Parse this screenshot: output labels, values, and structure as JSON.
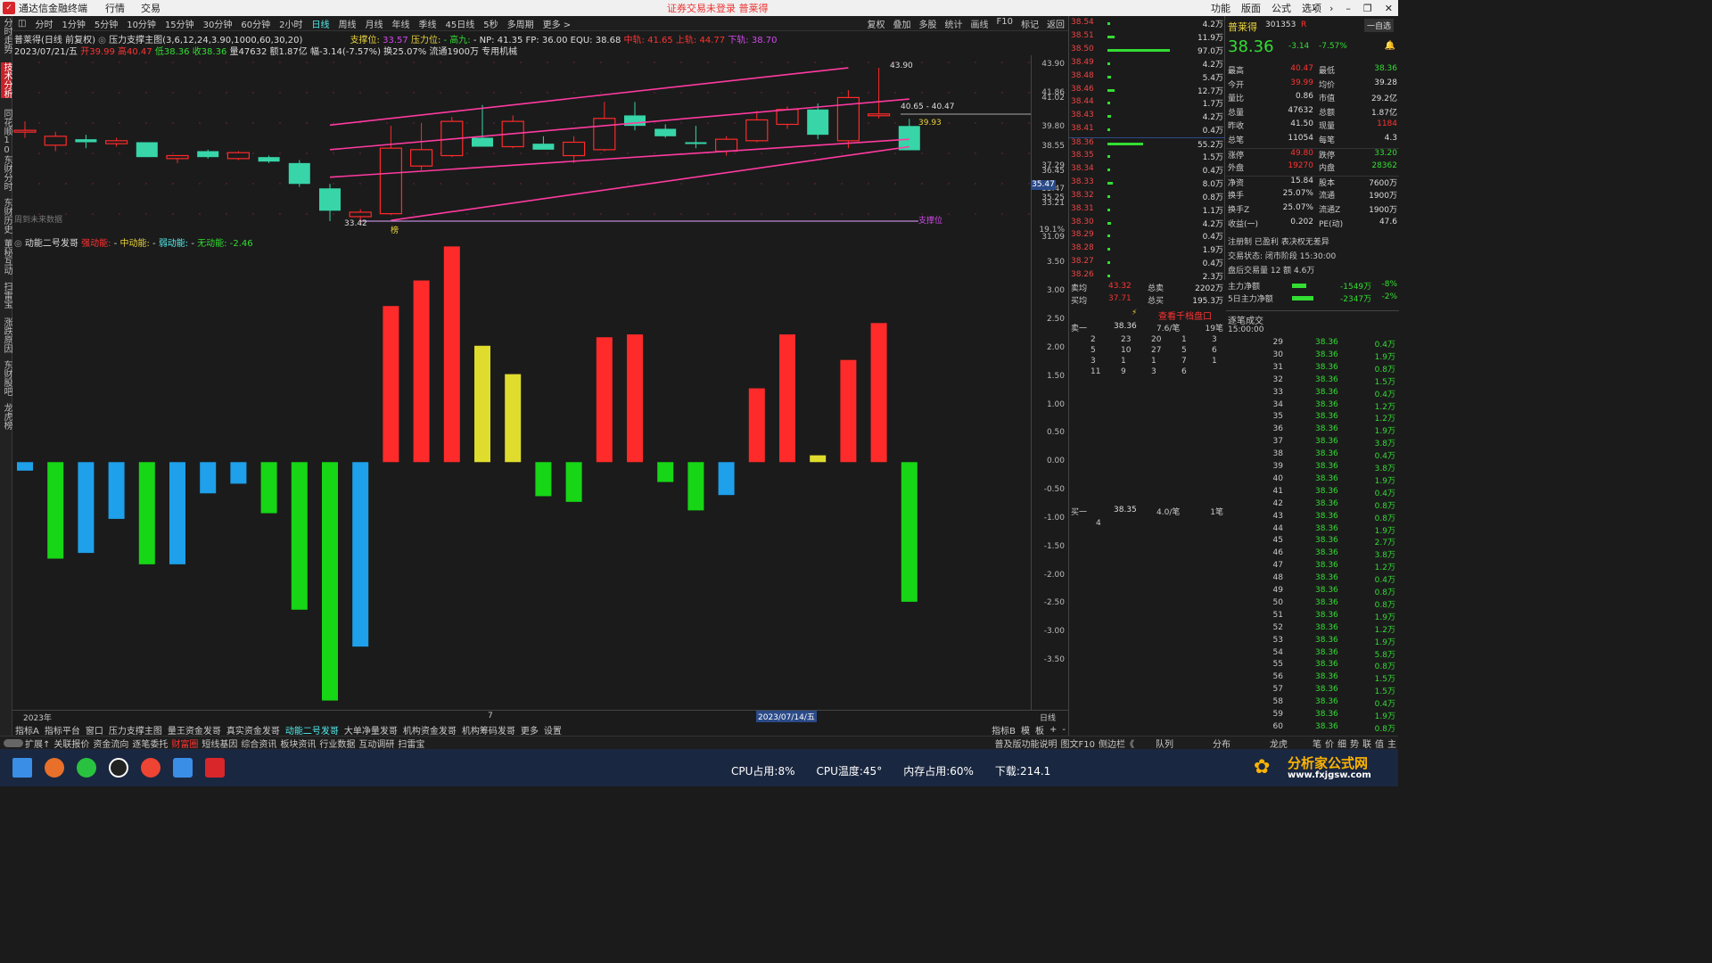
{
  "titlebar": {
    "app_name": "通达信金融终端",
    "menu": [
      "行情",
      "交易"
    ],
    "notice": "证券交易未登录  普莱得",
    "right_menu": [
      "功能",
      "版面",
      "公式",
      "选项"
    ]
  },
  "left_tabs": [
    "分时走势",
    "技术分析",
    "同花顺10",
    "东财分时",
    "东财历史",
    "董秘互动",
    "扫雷宝",
    "涨跌原因",
    "东财股吧",
    "龙虎榜"
  ],
  "periods": [
    "分时",
    "1分钟",
    "5分钟",
    "10分钟",
    "15分钟",
    "30分钟",
    "60分钟",
    "2小时",
    "日线",
    "周线",
    "月线",
    "年线",
    "季线",
    "45日线",
    "5秒",
    "多周期",
    "更多 >"
  ],
  "active_period": "日线",
  "period_right": [
    "复权",
    "叠加",
    "多股",
    "统计",
    "画线",
    "F10",
    "标记",
    "返回"
  ],
  "info_line1": {
    "stock": "普莱得(日线 前复权)",
    "indicator": "压力支撑主图(3,6,12,24,3.90,1000,60,30,20)",
    "support_label": "支撑位:",
    "support_val": "33.57",
    "pressure_label": "压力位:",
    "gaojiu": "- 高九:",
    "np": "- NP: 41.35 FP: 36.00 EQU: 38.68",
    "mid": "中轨: 41.65",
    "upper": "上轨: 44.77",
    "lower": "下轨: 38.70"
  },
  "info_line2": {
    "date": "2023/07/21/五",
    "open": "开39.99",
    "high": "高40.47",
    "low": "低38.36",
    "close": "收38.36",
    "rest": "量47632 额1.87亿 幅-3.14(-7.57%) 换25.07% 流通1900万 专用机械"
  },
  "main_axis_ticks": [
    "43.90",
    "41.86",
    "41.02",
    "39.80",
    "38.55",
    "37.29",
    "36.45",
    "35.47",
    "35.25",
    "33.21",
    "19.1%",
    "31.09"
  ],
  "main_annotations": {
    "high_mark": "43.90",
    "low_mark": "33.42",
    "range_label": "40.65 - 40.47",
    "last_mark": "39.93",
    "support_line": "支撑位",
    "no_data": "周到未来数据",
    "tag": "榜",
    "price_flag": "35.47"
  },
  "sub_header": {
    "title": "动能二号发哥",
    "strong": "强动能:",
    "mid": "中动能:",
    "weak": "弱动能:",
    "none": "无动能:",
    "none_val": "-2.46"
  },
  "sub_axis_ticks": [
    "3.50",
    "3.00",
    "2.50",
    "2.00",
    "1.50",
    "1.00",
    "0.50",
    "0.00",
    "-0.50",
    "-1.00",
    "-1.50",
    "-2.00",
    "-2.50",
    "-3.00",
    "-3.50"
  ],
  "date_bar": {
    "left": "2023年",
    "mid": "7",
    "sel": "2023/07/14/五",
    "right": "日线"
  },
  "tabbar1": [
    "指标A",
    "指标平台",
    "窗口",
    "压力支撑主图",
    "量王资金发哥",
    "真实资金发哥",
    "动能二号发哥",
    "大单净量发哥",
    "机构资金发哥",
    "机构筹码发哥",
    "更多",
    "设置"
  ],
  "tabbar1_active": "动能二号发哥",
  "tabbar1_right": [
    "指标B",
    "模",
    "板",
    "+",
    "-"
  ],
  "tabbar2": [
    "扩展↑",
    "关联报价",
    "资金流向",
    "逐笔委托",
    "财富圈",
    "短线基因",
    "综合资讯",
    "板块资讯",
    "行业数据",
    "互动调研",
    "扫雷宝"
  ],
  "tabbar2_active": "财富圈",
  "tabbar2_right": [
    "普及版功能说明",
    "图文F10",
    "侧边栏《",
    "队列",
    "分布",
    "龙虎",
    "笔",
    "价",
    "细",
    "势",
    "联",
    "值",
    "主"
  ],
  "chart_data": [
    {
      "type": "candlestick",
      "title": "普莱得(日线 前复权)",
      "ylim": [
        33.0,
        44.5
      ],
      "candles": [
        {
          "o": 39.7,
          "h": 40.3,
          "l": 39.2,
          "c": 39.7,
          "color": "red"
        },
        {
          "o": 38.7,
          "h": 39.6,
          "l": 38.3,
          "c": 39.3,
          "color": "red"
        },
        {
          "o": 39.1,
          "h": 39.4,
          "l": 38.5,
          "c": 38.9,
          "color": "cyan"
        },
        {
          "o": 38.8,
          "h": 39.2,
          "l": 38.6,
          "c": 39.0,
          "color": "red"
        },
        {
          "o": 38.9,
          "h": 38.9,
          "l": 37.9,
          "c": 37.9,
          "color": "cyan"
        },
        {
          "o": 37.8,
          "h": 38.0,
          "l": 37.5,
          "c": 38.0,
          "color": "red"
        },
        {
          "o": 38.3,
          "h": 38.4,
          "l": 37.8,
          "c": 37.9,
          "color": "cyan"
        },
        {
          "o": 37.8,
          "h": 38.3,
          "l": 37.7,
          "c": 38.2,
          "color": "red"
        },
        {
          "o": 37.9,
          "h": 38.0,
          "l": 37.5,
          "c": 37.6,
          "color": "cyan"
        },
        {
          "o": 37.5,
          "h": 37.7,
          "l": 35.9,
          "c": 36.1,
          "color": "cyan"
        },
        {
          "o": 35.8,
          "h": 36.1,
          "l": 33.6,
          "c": 34.3,
          "color": "cyan"
        },
        {
          "o": 33.9,
          "h": 34.4,
          "l": 33.4,
          "c": 34.2,
          "color": "red"
        },
        {
          "o": 34.1,
          "h": 40.0,
          "l": 34.0,
          "c": 38.5,
          "color": "red"
        },
        {
          "o": 37.3,
          "h": 40.2,
          "l": 37.0,
          "c": 38.4,
          "color": "red"
        },
        {
          "o": 38.0,
          "h": 40.6,
          "l": 37.9,
          "c": 40.3,
          "color": "red"
        },
        {
          "o": 39.2,
          "h": 41.4,
          "l": 38.6,
          "c": 38.6,
          "color": "cyan"
        },
        {
          "o": 38.6,
          "h": 40.7,
          "l": 38.5,
          "c": 40.3,
          "color": "red"
        },
        {
          "o": 38.8,
          "h": 39.3,
          "l": 38.7,
          "c": 38.4,
          "color": "cyan"
        },
        {
          "o": 38.0,
          "h": 39.3,
          "l": 37.5,
          "c": 38.9,
          "color": "red"
        },
        {
          "o": 38.4,
          "h": 41.6,
          "l": 38.3,
          "c": 40.5,
          "color": "red"
        },
        {
          "o": 40.7,
          "h": 41.6,
          "l": 39.7,
          "c": 40.0,
          "color": "cyan"
        },
        {
          "o": 39.8,
          "h": 40.1,
          "l": 39.2,
          "c": 39.3,
          "color": "cyan"
        },
        {
          "o": 38.9,
          "h": 40.0,
          "l": 38.5,
          "c": 38.9,
          "color": "cyan"
        },
        {
          "o": 38.3,
          "h": 39.3,
          "l": 38.0,
          "c": 39.1,
          "color": "red"
        },
        {
          "o": 39.0,
          "h": 41.0,
          "l": 38.9,
          "c": 40.4,
          "color": "red"
        },
        {
          "o": 40.1,
          "h": 41.3,
          "l": 39.8,
          "c": 41.1,
          "color": "red"
        },
        {
          "o": 41.1,
          "h": 41.5,
          "l": 39.1,
          "c": 39.4,
          "color": "cyan"
        },
        {
          "o": 39.0,
          "h": 42.4,
          "l": 38.5,
          "c": 41.9,
          "color": "red"
        },
        {
          "o": 40.8,
          "h": 43.9,
          "l": 40.5,
          "c": 40.7,
          "color": "red"
        },
        {
          "o": 39.99,
          "h": 40.47,
          "l": 38.36,
          "c": 38.36,
          "color": "cyan"
        }
      ]
    },
    {
      "type": "bar",
      "title": "动能二号发哥",
      "ylim": [
        -4.3,
        3.9
      ],
      "values": [
        -0.15,
        -1.7,
        -1.6,
        -1.0,
        -1.8,
        -1.8,
        -0.55,
        -0.38,
        -0.9,
        -2.6,
        -4.2,
        -3.25,
        2.75,
        3.2,
        3.8,
        2.05,
        1.55,
        -0.6,
        -0.7,
        2.2,
        2.25,
        -0.35,
        -0.85,
        -0.58,
        1.3,
        2.25,
        0.12,
        1.8,
        2.45,
        -2.46
      ],
      "colors": [
        "cyan",
        "green",
        "cyan",
        "cyan",
        "green",
        "cyan",
        "cyan",
        "cyan",
        "green",
        "green",
        "green",
        "cyan",
        "red",
        "red",
        "red",
        "yellow",
        "yellow",
        "green",
        "green",
        "red",
        "red",
        "green",
        "green",
        "cyan",
        "red",
        "red",
        "yellow",
        "red",
        "red",
        "green"
      ]
    }
  ],
  "orderbook": {
    "rows": [
      {
        "price": "38.54",
        "vol": "4.2万",
        "bar": 0
      },
      {
        "price": "38.51",
        "vol": "11.9万",
        "bar": 8
      },
      {
        "price": "38.50",
        "vol": "97.0万",
        "bar": 70
      },
      {
        "price": "38.49",
        "vol": "4.2万",
        "bar": 0
      },
      {
        "price": "38.48",
        "vol": "5.4万",
        "bar": 4
      },
      {
        "price": "38.46",
        "vol": "12.7万",
        "bar": 8
      },
      {
        "price": "38.44",
        "vol": "1.7万",
        "bar": 0
      },
      {
        "price": "38.43",
        "vol": "4.2万",
        "bar": 4
      },
      {
        "price": "38.41",
        "vol": "0.4万",
        "bar": 0
      },
      {
        "price": "38.36",
        "vol": "55.2万",
        "bar": 40
      },
      {
        "price": "38.35",
        "vol": "1.5万",
        "bar": 0
      },
      {
        "price": "38.34",
        "vol": "0.4万",
        "bar": 0
      },
      {
        "price": "38.33",
        "vol": "8.0万",
        "bar": 6
      },
      {
        "price": "38.32",
        "vol": "0.8万",
        "bar": 0
      },
      {
        "price": "38.31",
        "vol": "1.1万",
        "bar": 0
      },
      {
        "price": "38.30",
        "vol": "4.2万",
        "bar": 4
      },
      {
        "price": "38.29",
        "vol": "0.4万",
        "bar": 0
      },
      {
        "price": "38.28",
        "vol": "1.9万",
        "bar": 0
      },
      {
        "price": "38.27",
        "vol": "0.4万",
        "bar": 0
      },
      {
        "price": "38.26",
        "vol": "2.3万",
        "bar": 0
      }
    ],
    "sell_avg_label": "卖均",
    "sell_avg": "43.32",
    "sell_total_label": "总卖",
    "sell_total": "2202万",
    "buy_avg_label": "买均",
    "buy_avg": "37.71",
    "buy_total_label": "总买",
    "buy_total": "195.3万",
    "queue_link": "查看千档盘口",
    "sell1_label": "卖一",
    "sell1_price": "38.36",
    "sell1_avg": "7.6/笔",
    "sell1_count": "19笔",
    "sell1_queue": [
      [
        "2",
        "23",
        "20",
        "1",
        "3"
      ],
      [
        "5",
        "10",
        "27",
        "5",
        "6"
      ],
      [
        "3",
        "1",
        "1",
        "7",
        "1"
      ],
      [
        "11",
        "9",
        "3",
        "6",
        ""
      ]
    ],
    "buy1_label": "买一",
    "buy1_price": "38.35",
    "buy1_avg": "4.0/笔",
    "buy1_count": "1笔",
    "buy1_queue": [
      "4"
    ]
  },
  "quote": {
    "name": "普莱得",
    "code": "301353",
    "flag": "R",
    "zixuan": "一自选",
    "price": "38.36",
    "change": "-3.14",
    "pct": "-7.57%",
    "rows": [
      [
        "最高",
        "40.47",
        "最低",
        "38.36"
      ],
      [
        "今开",
        "39.99",
        "均价",
        "39.28"
      ],
      [
        "量比",
        "0.86",
        "市值",
        "29.2亿"
      ],
      [
        "总量",
        "47632",
        "总额",
        "1.87亿"
      ],
      [
        "昨收",
        "41.50",
        "现量",
        "1184"
      ],
      [
        "总笔",
        "11054",
        "每笔",
        "4.3"
      ],
      [
        "涨停",
        "49.80",
        "跌停",
        "33.20"
      ],
      [
        "外盘",
        "19270",
        "内盘",
        "28362"
      ],
      [
        "净资",
        "15.84",
        "股本",
        "7600万"
      ],
      [
        "换手",
        "25.07%",
        "流通",
        "1900万"
      ],
      [
        "换手Z",
        "25.07%",
        "流通Z",
        "1900万"
      ],
      [
        "收益(一)",
        "0.202",
        "PE(动)",
        "47.6"
      ]
    ],
    "reg": "注册制 已盈利 表决权无差异",
    "status": "交易状态: 闭市阶段 15:30:00",
    "after": "盘后交易量 12  额 4.6万",
    "main_flow_label": "主力净额",
    "main_flow": "-1549万",
    "main_flow_pct": "-8%",
    "main5_label": "5日主力净额",
    "main5": "-2347万",
    "main5_pct": "-2%",
    "ticks_title": "逐笔成交",
    "ticks_time": "15:00:00",
    "ticks": [
      [
        "29",
        "38.36",
        "0.4万"
      ],
      [
        "30",
        "38.36",
        "1.9万"
      ],
      [
        "31",
        "38.36",
        "0.8万"
      ],
      [
        "32",
        "38.36",
        "1.5万"
      ],
      [
        "33",
        "38.36",
        "0.4万"
      ],
      [
        "34",
        "38.36",
        "1.2万"
      ],
      [
        "35",
        "38.36",
        "1.2万"
      ],
      [
        "36",
        "38.36",
        "1.9万"
      ],
      [
        "37",
        "38.36",
        "3.8万"
      ],
      [
        "38",
        "38.36",
        "0.4万"
      ],
      [
        "39",
        "38.36",
        "3.8万"
      ],
      [
        "40",
        "38.36",
        "1.9万"
      ],
      [
        "41",
        "38.36",
        "0.4万"
      ],
      [
        "42",
        "38.36",
        "0.8万"
      ],
      [
        "43",
        "38.36",
        "0.8万"
      ],
      [
        "44",
        "38.36",
        "1.9万"
      ],
      [
        "45",
        "38.36",
        "2.7万"
      ],
      [
        "46",
        "38.36",
        "3.8万"
      ],
      [
        "47",
        "38.36",
        "1.2万"
      ],
      [
        "48",
        "38.36",
        "0.4万"
      ],
      [
        "49",
        "38.36",
        "0.8万"
      ],
      [
        "50",
        "38.36",
        "0.8万"
      ],
      [
        "51",
        "38.36",
        "1.9万"
      ],
      [
        "52",
        "38.36",
        "1.2万"
      ],
      [
        "53",
        "38.36",
        "1.9万"
      ],
      [
        "54",
        "38.36",
        "5.8万"
      ],
      [
        "55",
        "38.36",
        "0.8万"
      ],
      [
        "56",
        "38.36",
        "1.5万"
      ],
      [
        "57",
        "38.36",
        "1.5万"
      ],
      [
        "58",
        "38.36",
        "0.4万"
      ],
      [
        "59",
        "38.36",
        "1.9万"
      ],
      [
        "60",
        "38.36",
        "0.8万"
      ]
    ]
  },
  "taskbar": {
    "cpu": "CPU占用:8%",
    "temp": "CPU温度:45°",
    "mem": "内存占用:60%",
    "dl": "下载:214.1",
    "brand": "分析家公式网",
    "brand_url": "www.fxjgsw.com"
  },
  "colors": {
    "up": "#ff2a2a",
    "down": "#37d5a8",
    "green": "#16d616",
    "cyan": "#1ea0ea",
    "yellow": "#e0dc2e",
    "channel": "#ff3aa0"
  }
}
